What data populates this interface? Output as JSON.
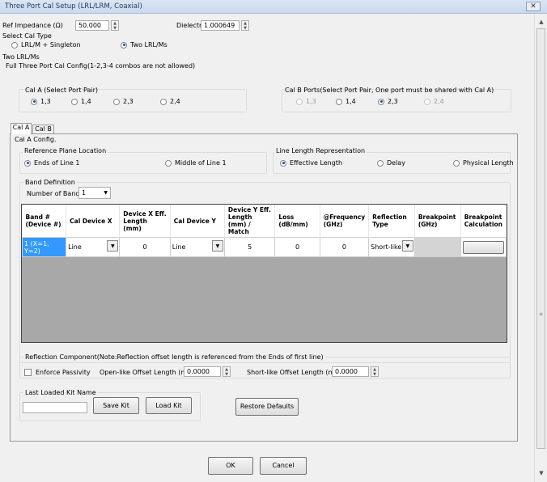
{
  "window": {
    "title": "Three Port Cal Setup (LRL/LRM, Coaxial)"
  },
  "ref_impedance": {
    "label": "Ref Impedance (Ω)",
    "value": "50.000"
  },
  "dielectric": {
    "label": "Dielectric",
    "value": "1.000649"
  },
  "cal_type": {
    "label": "Select Cal Type",
    "options": [
      "LRL/M + Singleton",
      "Two LRL/Ms"
    ],
    "selected": "Two LRL/Ms"
  },
  "two_lrl": {
    "label": "Two LRL/Ms",
    "subtitle": "Full Three Port Cal Config(1-2,3-4 combos are not allowed)"
  },
  "cal_a_ports": {
    "label": "Cal A (Select Port Pair)",
    "options": [
      "1,3",
      "1,4",
      "2,3",
      "2,4"
    ],
    "selected": "1,3"
  },
  "cal_b_ports": {
    "label": "Cal B Ports(Select Port Pair, One port must be shared with Cal A)",
    "options": [
      "1,3",
      "1,4",
      "2,3",
      "2,4"
    ],
    "selected": "2,3"
  },
  "tabs": [
    {
      "label": "Cal A"
    },
    {
      "label": "Cal B"
    }
  ],
  "cal_a_config": {
    "label": "Cal A Config."
  },
  "ref_plane": {
    "label": "Reference Plane Location",
    "options": [
      "Ends of Line 1",
      "Middle of Line 1"
    ],
    "selected": "Ends of Line 1"
  },
  "line_length": {
    "label": "Line Length Representation",
    "options": [
      "Effective Length",
      "Delay",
      "Physical Length"
    ],
    "selected": "Effective Length"
  },
  "band_def": {
    "label": "Band Definition",
    "num_bands_label": "Number of Bands:",
    "num_bands": "1"
  },
  "table": {
    "headers": [
      "Band # (Device #)",
      "Cal Device X",
      "Device X Eff. Length (mm)",
      "Cal Device Y",
      "Device Y Eff. Length (mm) / Match",
      "Loss (dB/mm)",
      "@Frequency (GHz)",
      "Reflection Type",
      "Breakpoint (GHz)",
      "Breakpoint Calculation"
    ],
    "rows": [
      {
        "band": "1 (X=1, Y=2)",
        "dev_x": "Line",
        "x_len": "0",
        "dev_y": "Line",
        "y_len": "5",
        "loss": "0",
        "freq": "0",
        "refl": "Short-like",
        "bp": "",
        "bp_calc": ""
      }
    ]
  },
  "reflection": {
    "label": "Reflection Component(Note:Reflection offset length is referenced from the Ends of first line)",
    "passivity_label": "Enforce Passivity",
    "passivity_checked": false,
    "open_label": "Open-like Offset Length (mm)",
    "open_value": "0.0000",
    "short_label": "Short-like Offset Length (mm)",
    "short_value": "0.0000"
  },
  "kit": {
    "label": "Last Loaded Kit Name",
    "name": "",
    "save": "Save Kit",
    "load": "Load Kit"
  },
  "restore": "Restore Defaults",
  "ok": "OK",
  "cancel": "Cancel",
  "icons": {
    "close": "close-icon",
    "scroll_up": "scroll-up-icon",
    "scroll_down": "scroll-down-icon"
  }
}
